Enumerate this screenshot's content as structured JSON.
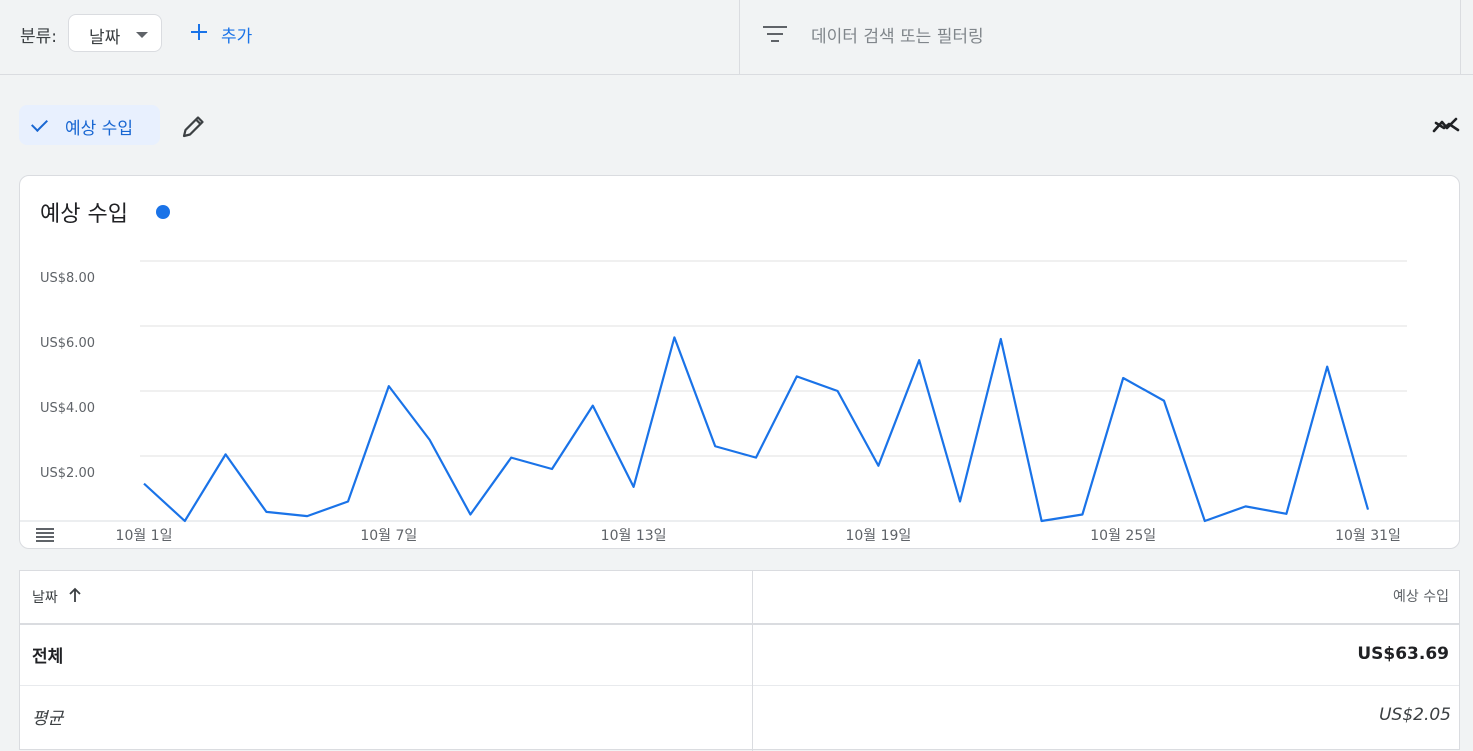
{
  "toolbar": {
    "breakdown_label": "분류:",
    "dimension_value": "날짜",
    "add_label": "추가",
    "filter_placeholder": "데이터 검색 또는 필터링"
  },
  "metric_chip": {
    "label": "예상 수입"
  },
  "chart": {
    "title": "예상 수입",
    "legend_color": "#1a73e8",
    "line_color": "#1a73e8"
  },
  "chart_data": {
    "type": "line",
    "title": "예상 수입",
    "x": [
      1,
      2,
      3,
      4,
      5,
      6,
      7,
      8,
      9,
      10,
      11,
      12,
      13,
      14,
      15,
      16,
      17,
      18,
      19,
      20,
      21,
      22,
      23,
      24,
      25,
      26,
      27,
      28,
      29,
      30,
      31
    ],
    "tick_labels": [
      "10월 1일",
      "10월 7일",
      "10월 13일",
      "10월 19일",
      "10월 25일",
      "10월 31일"
    ],
    "tick_days": [
      1,
      7,
      13,
      19,
      25,
      31
    ],
    "y_tick_labels": [
      "US$2.00",
      "US$4.00",
      "US$6.00",
      "US$8.00"
    ],
    "y_ticks": [
      2,
      4,
      6,
      8
    ],
    "ylim": [
      0,
      8.5
    ],
    "series": [
      {
        "values": [
          1.15,
          0.0,
          2.05,
          0.28,
          0.15,
          0.6,
          4.15,
          2.5,
          0.2,
          1.95,
          1.6,
          3.55,
          1.05,
          5.65,
          2.3,
          1.95,
          4.45,
          4.0,
          1.7,
          4.95,
          0.6,
          5.6,
          0.0,
          0.2,
          4.4,
          3.7,
          0.0,
          0.45,
          0.22,
          4.75,
          0.35
        ]
      }
    ],
    "grid": true
  },
  "table": {
    "col_date": "날짜",
    "col_metric": "예상 수입",
    "total_label": "전체",
    "total_value": "US$63.69",
    "avg_label": "평균",
    "avg_value": "US$2.05"
  }
}
